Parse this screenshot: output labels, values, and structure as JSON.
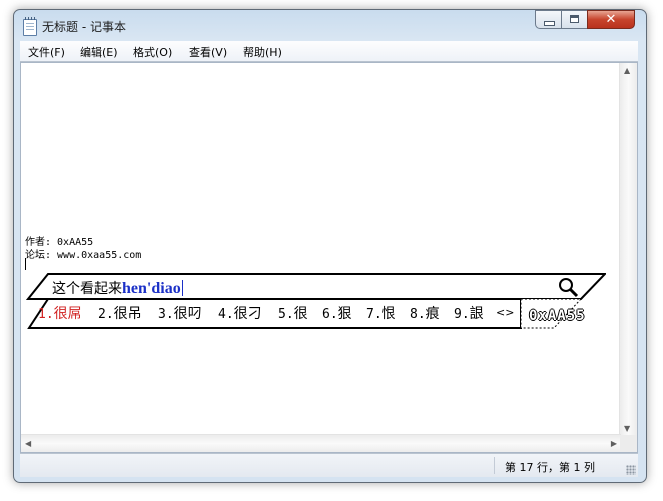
{
  "window": {
    "title": "无标题 - 记事本"
  },
  "controls": {
    "close_glyph": "✕"
  },
  "menu": [
    {
      "label": "文件(F)"
    },
    {
      "label": "编辑(E)"
    },
    {
      "label": "格式(O)"
    },
    {
      "label": "查看(V)"
    },
    {
      "label": "帮助(H)"
    }
  ],
  "document": {
    "lines": [
      "作者: 0xAA55",
      "论坛: www.0xaa55.com"
    ]
  },
  "ime": {
    "composed": "这个看起来",
    "pinyin": "hen'diao",
    "candidates": [
      {
        "num": "1.",
        "text": "很屌"
      },
      {
        "num": "2.",
        "text": "很吊"
      },
      {
        "num": "3.",
        "text": "很叼"
      },
      {
        "num": "4.",
        "text": "很刁"
      },
      {
        "num": "5.",
        "text": "很"
      },
      {
        "num": "6.",
        "text": "狠"
      },
      {
        "num": "7.",
        "text": "恨"
      },
      {
        "num": "8.",
        "text": "痕"
      },
      {
        "num": "9.",
        "text": "詪"
      }
    ],
    "nav": "<>",
    "brand": "0xAA55",
    "search_icon": "magnifier-icon"
  },
  "status": {
    "position": "第 17 行，第 1 列"
  },
  "scroll": {
    "up": "▲",
    "down": "▼",
    "left": "◀",
    "right": "▶"
  }
}
